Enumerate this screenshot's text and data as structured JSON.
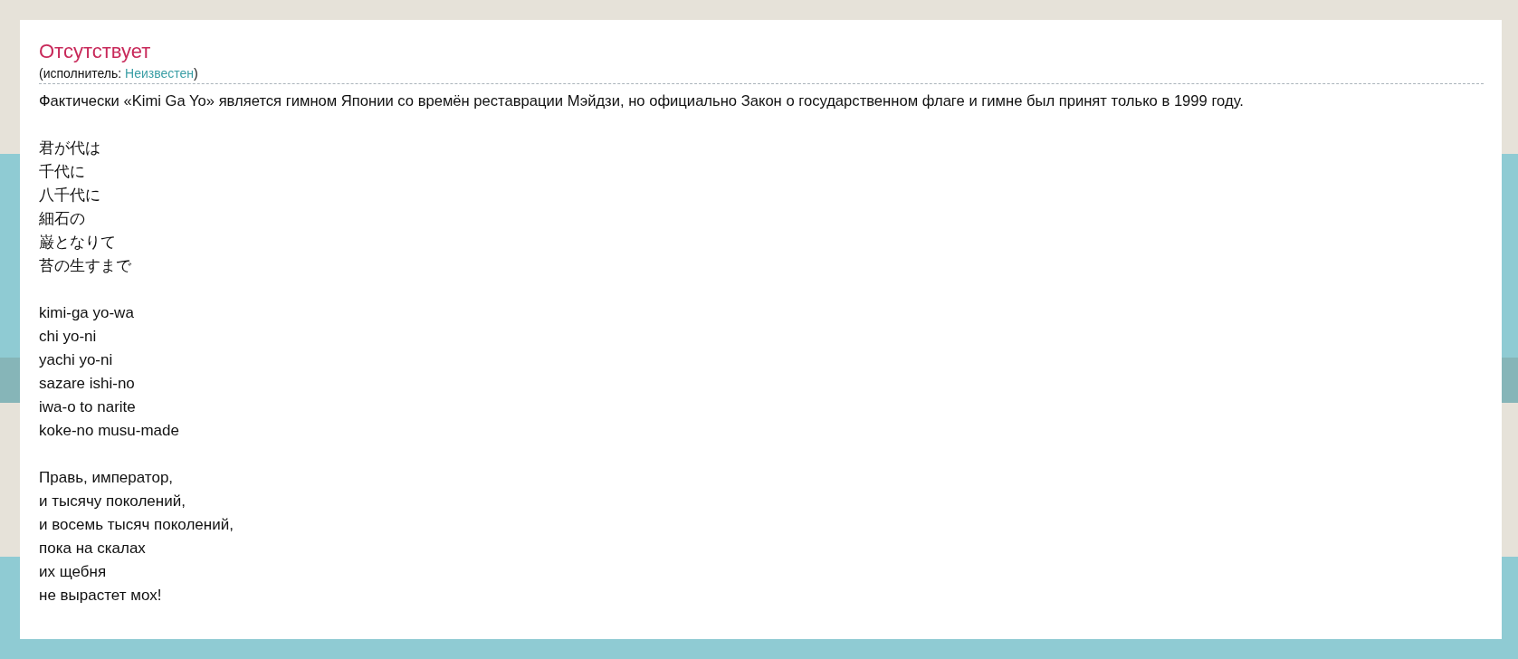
{
  "song": {
    "title": "Отсутствует",
    "artist_label": "(исполнитель: ",
    "artist": "Неизвестен",
    "artist_close": ")"
  },
  "intro": "Фактически «Kimi Ga Yo» является гимном Японии со времён реставрации Мэйдзи, но официально Закон о государственном флаге и гимне был принят только в 1999 году.",
  "stanzas": [
    {
      "lines": [
        "君が代は",
        "千代に",
        "八千代に",
        "細石の",
        "巌となりて",
        "苔の生すまで"
      ]
    },
    {
      "lines": [
        "kimi-ga yo-wa",
        "chi yo-ni",
        "yachi yo-ni",
        "sazare ishi-no",
        "iwa-o to narite",
        "koke-no musu-made"
      ]
    },
    {
      "lines": [
        "Правь, император,",
        "и тысячу поколений,",
        "и восемь тысяч поколений,",
        "пока на скалах",
        "их щебня",
        "не вырастет мох!"
      ]
    }
  ]
}
